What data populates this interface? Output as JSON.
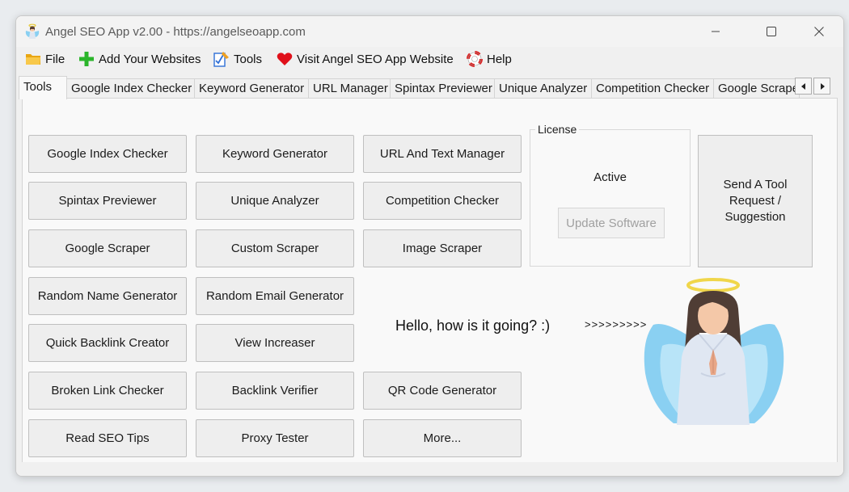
{
  "window": {
    "title": "Angel SEO App v2.00 - https://angelseoapp.com"
  },
  "menu": [
    {
      "label": "File",
      "icon": "folder-icon"
    },
    {
      "label": "Add Your Websites",
      "icon": "plus-icon"
    },
    {
      "label": "Tools",
      "icon": "tools-icon"
    },
    {
      "label": "Visit Angel SEO App Website",
      "icon": "heart-icon"
    },
    {
      "label": "Help",
      "icon": "lifebuoy-icon"
    }
  ],
  "tabs": [
    "Tools",
    "Google Index Checker",
    "Keyword Generator",
    "URL Manager",
    "Spintax Previewer",
    "Unique Analyzer",
    "Competition Checker",
    "Google Scraper"
  ],
  "active_tab": "Tools",
  "tool_buttons": [
    "Google Index Checker",
    "Keyword Generator",
    "URL And Text Manager",
    "Spintax Previewer",
    "Unique Analyzer",
    "Competition Checker",
    "Google Scraper",
    "Custom Scraper",
    "Image Scraper",
    "Random Name Generator",
    "Random Email Generator",
    "Quick Backlink Creator",
    "View Increaser",
    "Broken Link Checker",
    "Backlink Verifier",
    "QR Code Generator",
    "Read SEO Tips",
    "Proxy Tester",
    "More..."
  ],
  "license": {
    "legend": "License",
    "status": "Active",
    "update_button": "Update Software"
  },
  "suggest_button": "Send A Tool Request / Suggestion",
  "greeting": "Hello, how is it going? :)",
  "arrows": ">>>>>>>>>",
  "colors": {
    "plus": "#2bb52b",
    "heart": "#e0101a",
    "folder": "#f5b419",
    "angel_wings": "#8ad0f2",
    "halo": "#f0d64a"
  }
}
